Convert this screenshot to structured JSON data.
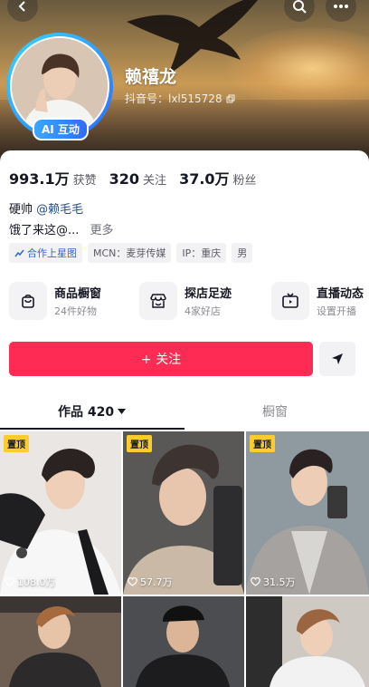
{
  "profile": {
    "nickname": "赖禧龙",
    "douyin_id": "抖音号：lxl515728",
    "ai_badge": "AI 互动"
  },
  "stats": [
    {
      "value": "993.1万",
      "label": "获赞"
    },
    {
      "value": "320",
      "label": "关注"
    },
    {
      "value": "37.0万",
      "label": "粉丝"
    }
  ],
  "bio": {
    "line1_prefix": "硬帅",
    "line1_mention": "@赖毛毛",
    "line2": "饿了来这@...",
    "more_label": "更多"
  },
  "tags": [
    {
      "label": "合作上星图",
      "icon": "star-chart-icon"
    },
    {
      "label": "MCN：麦芽传媒"
    },
    {
      "label": "IP：重庆"
    },
    {
      "label": "男"
    }
  ],
  "services": [
    {
      "title": "商品橱窗",
      "sub": "24件好物",
      "icon": "shopping-bag-icon"
    },
    {
      "title": "探店足迹",
      "sub": "4家好店",
      "icon": "store-icon"
    },
    {
      "title": "直播动态",
      "sub": "设置开播",
      "icon": "tv-icon"
    }
  ],
  "actions": {
    "follow_label": "+ 关注",
    "share_icon": "send-icon"
  },
  "tabs": {
    "works_label": "作品 420",
    "window_label": "橱窗"
  },
  "posts": [
    {
      "pinned": "置顶",
      "likes": "108.0万"
    },
    {
      "pinned": "置顶",
      "likes": "57.7万"
    },
    {
      "pinned": "置顶",
      "likes": "31.5万"
    },
    {
      "pinned": "",
      "likes": ""
    },
    {
      "pinned": "",
      "likes": ""
    },
    {
      "pinned": "",
      "likes": ""
    }
  ],
  "colors": {
    "follow": "#fe2c55",
    "mention": "#2a4e8c",
    "pin": "#facc2e",
    "avatar_ring": "#2b6bff"
  }
}
